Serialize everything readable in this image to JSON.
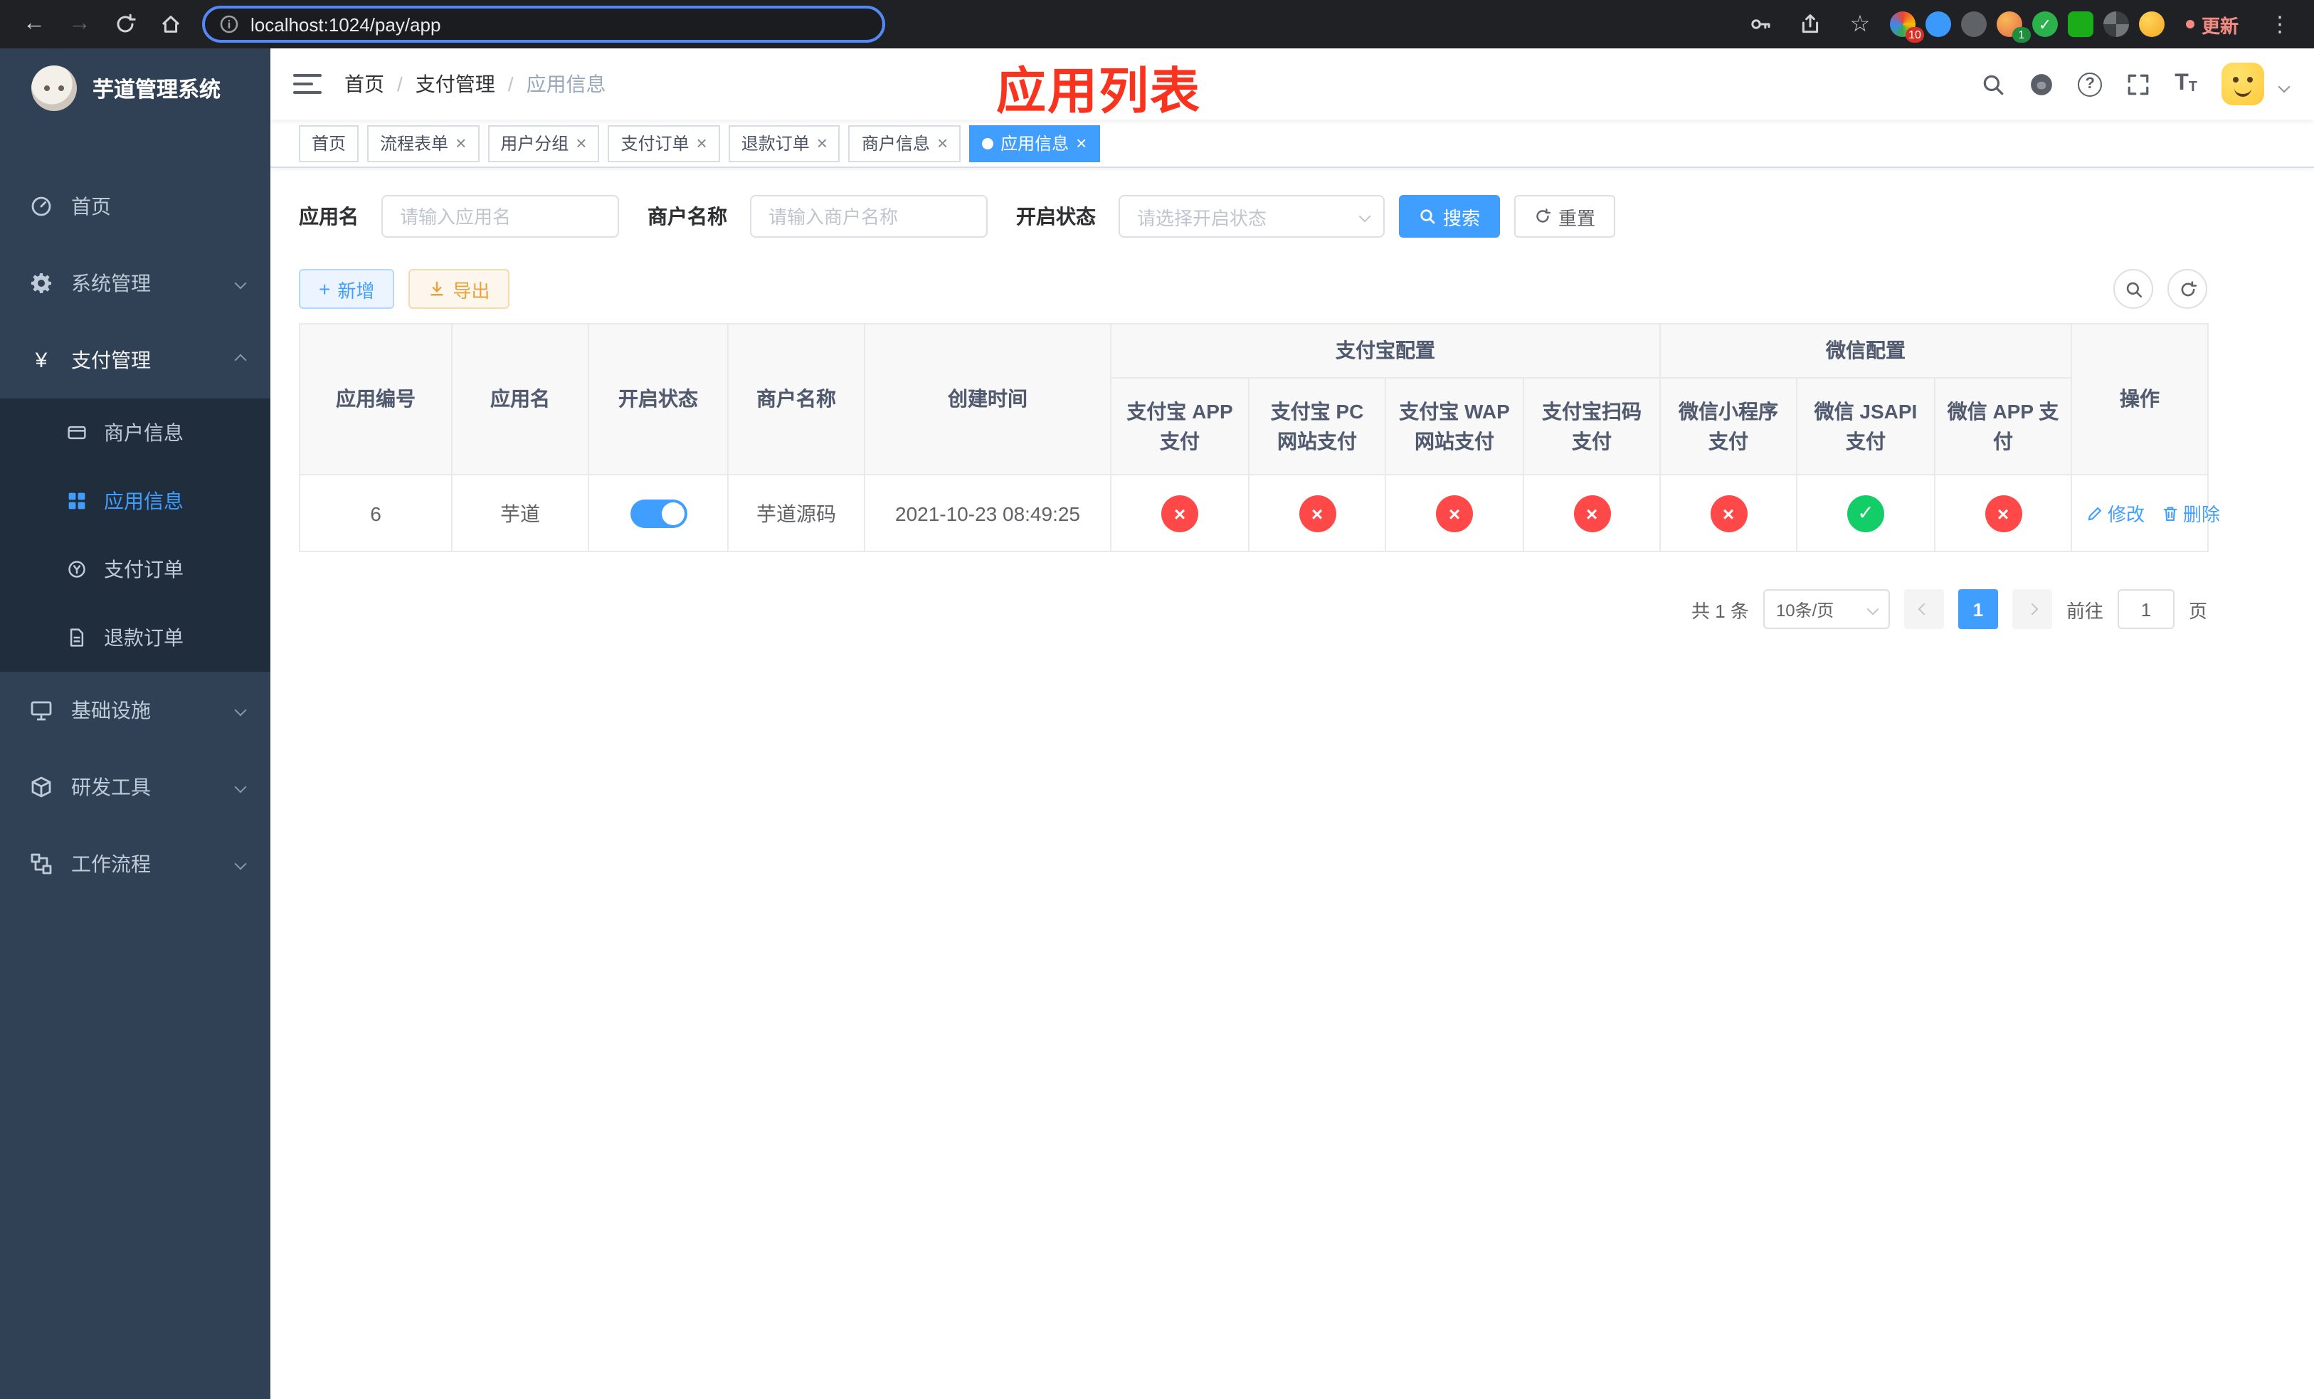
{
  "browser": {
    "url": "localhost:1024/pay/app",
    "update_label": "更新",
    "extension_badge_red": "10",
    "extension_badge_green": "1"
  },
  "app_header": {
    "logo_title": "芋道管理系统",
    "breadcrumb": [
      "首页",
      "支付管理",
      "应用信息"
    ],
    "breadcrumb_separator": "/"
  },
  "overlay_annotation": {
    "text": "应用列表",
    "color": "#f8341f"
  },
  "sidebar": {
    "items": [
      {
        "label": "首页"
      },
      {
        "label": "系统管理"
      },
      {
        "label": "支付管理",
        "children": [
          {
            "label": "商户信息"
          },
          {
            "label": "应用信息"
          },
          {
            "label": "支付订单"
          },
          {
            "label": "退款订单"
          }
        ]
      },
      {
        "label": "基础设施"
      },
      {
        "label": "研发工具"
      },
      {
        "label": "工作流程"
      }
    ]
  },
  "tabs": [
    {
      "label": "首页"
    },
    {
      "label": "流程表单"
    },
    {
      "label": "用户分组"
    },
    {
      "label": "支付订单"
    },
    {
      "label": "退款订单"
    },
    {
      "label": "商户信息"
    },
    {
      "label": "应用信息"
    }
  ],
  "filters": {
    "app_name_label": "应用名",
    "app_name_placeholder": "请输入应用名",
    "merchant_name_label": "商户名称",
    "merchant_name_placeholder": "请输入商户名称",
    "status_label": "开启状态",
    "status_placeholder": "请选择开启状态",
    "search_button": "搜索",
    "reset_button": "重置"
  },
  "toolbar": {
    "add_button": "新增",
    "export_button": "导出"
  },
  "table": {
    "groups": [
      "支付宝配置",
      "微信配置"
    ],
    "columns": [
      "应用编号",
      "应用名",
      "开启状态",
      "商户名称",
      "创建时间",
      "支付宝 APP 支付",
      "支付宝 PC 网站支付",
      "支付宝 WAP 网站支付",
      "支付宝扫码支付",
      "微信小程序支付",
      "微信 JSAPI 支付",
      "微信 APP 支付",
      "操作"
    ],
    "rows": [
      {
        "app_id": "6",
        "app_name": "芋道",
        "enabled": true,
        "merchant_name": "芋道源码",
        "create_time": "2021-10-23 08:49:25",
        "configs": [
          false,
          false,
          false,
          false,
          false,
          true,
          false
        ],
        "edit_label": "修改",
        "delete_label": "删除"
      }
    ]
  },
  "pagination": {
    "total": "共 1 条",
    "page_size": "10条/页",
    "current_page": "1",
    "goto_label": "前往",
    "goto_value": "1",
    "goto_unit": "页"
  },
  "glyphs": {
    "close": "×",
    "plus": "+",
    "yen": "¥",
    "question": "?",
    "font_large": "T",
    "font_small": "T",
    "status_yes": "✓",
    "status_no": "×",
    "more_vertical": "⋮",
    "star": "☆",
    "back_arrow": "←",
    "forward_arrow": "→"
  },
  "colors": {
    "primary": "#409eff",
    "success": "#13ce66",
    "danger": "#ff4949",
    "warning": "#e6a23c",
    "sidebar_bg": "#304156",
    "sidebar_submenu_bg": "#1f2d3d",
    "sidebar_text": "#bfcbd9",
    "annotation_red": "#f8341f",
    "browser_bg": "#202124"
  }
}
